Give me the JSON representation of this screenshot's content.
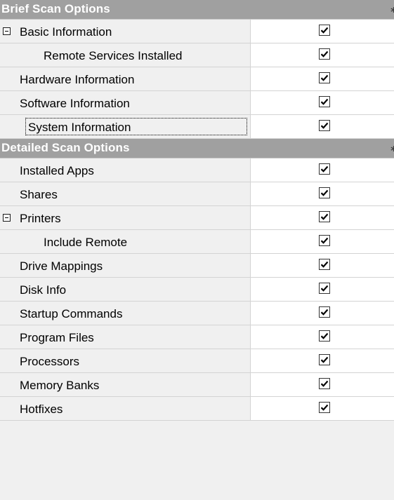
{
  "sections": [
    {
      "title": "Brief Scan Options",
      "items": [
        {
          "label": "Basic Information",
          "checked": true,
          "expanded": true,
          "level": 0
        },
        {
          "label": "Remote Services Installed",
          "checked": true,
          "level": 2
        },
        {
          "label": "Hardware Information",
          "checked": true,
          "level": 1
        },
        {
          "label": "Software Information",
          "checked": true,
          "level": 1
        },
        {
          "label": "System Information",
          "checked": true,
          "level": 1,
          "selected": true
        }
      ]
    },
    {
      "title": "Detailed Scan Options",
      "items": [
        {
          "label": "Installed Apps",
          "checked": true,
          "level": 1
        },
        {
          "label": "Shares",
          "checked": true,
          "level": 1
        },
        {
          "label": "Printers",
          "checked": true,
          "expanded": true,
          "level": 0
        },
        {
          "label": "Include Remote",
          "checked": true,
          "level": 2
        },
        {
          "label": "Drive Mappings",
          "checked": true,
          "level": 1
        },
        {
          "label": "Disk Info",
          "checked": true,
          "level": 1
        },
        {
          "label": "Startup Commands",
          "checked": true,
          "level": 1
        },
        {
          "label": "Program Files",
          "checked": true,
          "level": 1
        },
        {
          "label": "Processors",
          "checked": true,
          "level": 1
        },
        {
          "label": "Memory Banks",
          "checked": true,
          "level": 1
        },
        {
          "label": "Hotfixes",
          "checked": true,
          "level": 1
        }
      ]
    }
  ],
  "icons": {
    "category_collapse": "collapse-icon",
    "expander": "minus-box-icon",
    "checkmark": "checkmark-icon"
  },
  "colors": {
    "category_bg": "#a0a0a0",
    "category_text": "#ffffff",
    "grid_bg": "#f0f0f0",
    "value_bg": "#ffffff",
    "grid_line": "#d3d3d3"
  }
}
